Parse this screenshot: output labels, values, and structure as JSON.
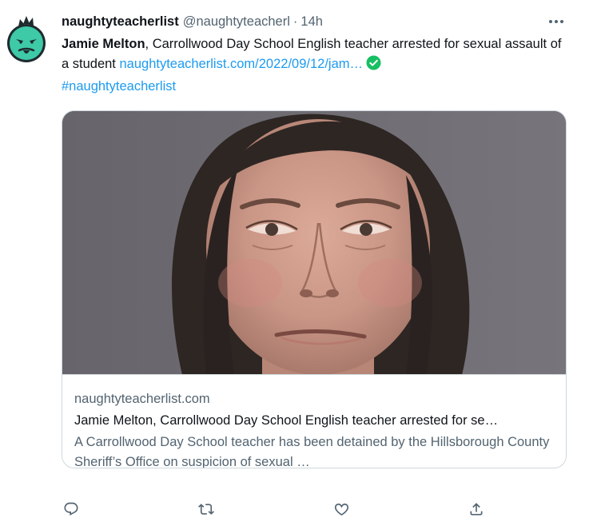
{
  "tweet": {
    "display_name": "naughtyteacherlist",
    "handle": "@naughtyteacherl",
    "separator": "·",
    "time": "14h",
    "text_name": "Jamie Melton",
    "text_body": ", Carrollwood Day School English teacher arrested for sexual assault of a student ",
    "text_link": "naughtyteacherlist.com/2022/09/12/jam…",
    "hashtag": "#naughtyteacherlist"
  },
  "card": {
    "domain": "naughtyteacherlist.com",
    "title": "Jamie Melton, Carrollwood Day School English teacher arrested for se…",
    "description": "A Carrollwood Day School teacher has been detained by the Hillsborough County Sheriff’s Office on suspicion of sexual …"
  },
  "icons": {
    "avatar": "green-devil-face-icon",
    "more": "more-horizontal-icon",
    "check": "check-circle-icon",
    "reply": "reply-icon",
    "retweet": "retweet-icon",
    "like": "heart-icon",
    "share": "share-icon"
  },
  "colors": {
    "link": "#1d9bf0",
    "secondary_text": "#536471",
    "primary_text": "#0f1419",
    "border": "#cfd9de",
    "avatar_green": "#3ec9a7",
    "check_green": "#17bf63"
  }
}
